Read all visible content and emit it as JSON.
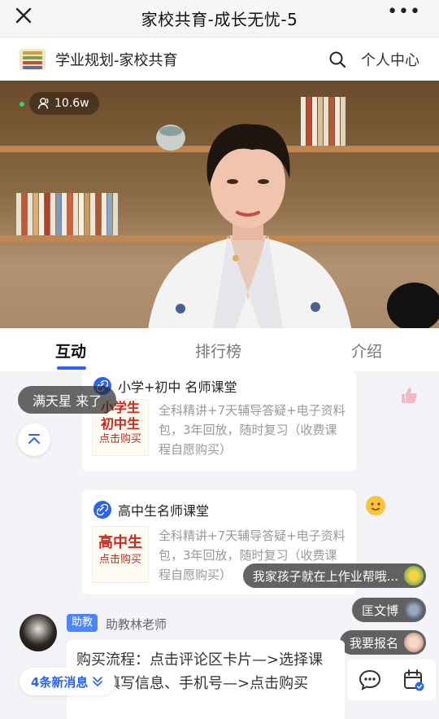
{
  "topbar": {
    "title": "家校共育-成长无忧-5",
    "close_icon": "close-icon",
    "more_label": "•••"
  },
  "header": {
    "brand": "学业规划-家校共育",
    "search_icon": "search-icon",
    "user_center": "个人中心"
  },
  "video": {
    "viewers": "10.6w",
    "viewers_icon": "person-icon"
  },
  "tabs": [
    {
      "label": "互动",
      "active": true
    },
    {
      "label": "排行榜"
    },
    {
      "label": "介绍"
    }
  ],
  "chat": {
    "join_notice": "满天星 来了",
    "cards": [
      {
        "title": "小学+初中 名师课堂",
        "thumb_line1": "小学生",
        "thumb_line2": "初中生",
        "thumb_line3": "点击购买",
        "desc": "全科精讲+7天辅导答疑+电子资料包，3年回放，随时复习（收费课程自愿购买）"
      },
      {
        "title": "高中生名师课堂",
        "thumb_line1": "高中生",
        "thumb_line2": "点击购买",
        "desc": "全科精讲+7天辅导答疑+电子资料包，3年回放，随时复习（收费课程自愿购买）"
      }
    ],
    "floating_comments": [
      {
        "text": "我家孩子就在上作业帮哦..."
      },
      {
        "text": "匡文博"
      },
      {
        "text": "我要报名"
      }
    ],
    "teacher": {
      "badge": "助教",
      "name": "助教林老师",
      "message": "购买流程：点击评论区卡片—>选择课程、填写信息、手机号—>点击购买"
    },
    "new_messages": "4条新消息"
  },
  "colors": {
    "accent": "#2b63f5",
    "badge": "#4b86ff",
    "thumb_red": "#d2261e"
  }
}
